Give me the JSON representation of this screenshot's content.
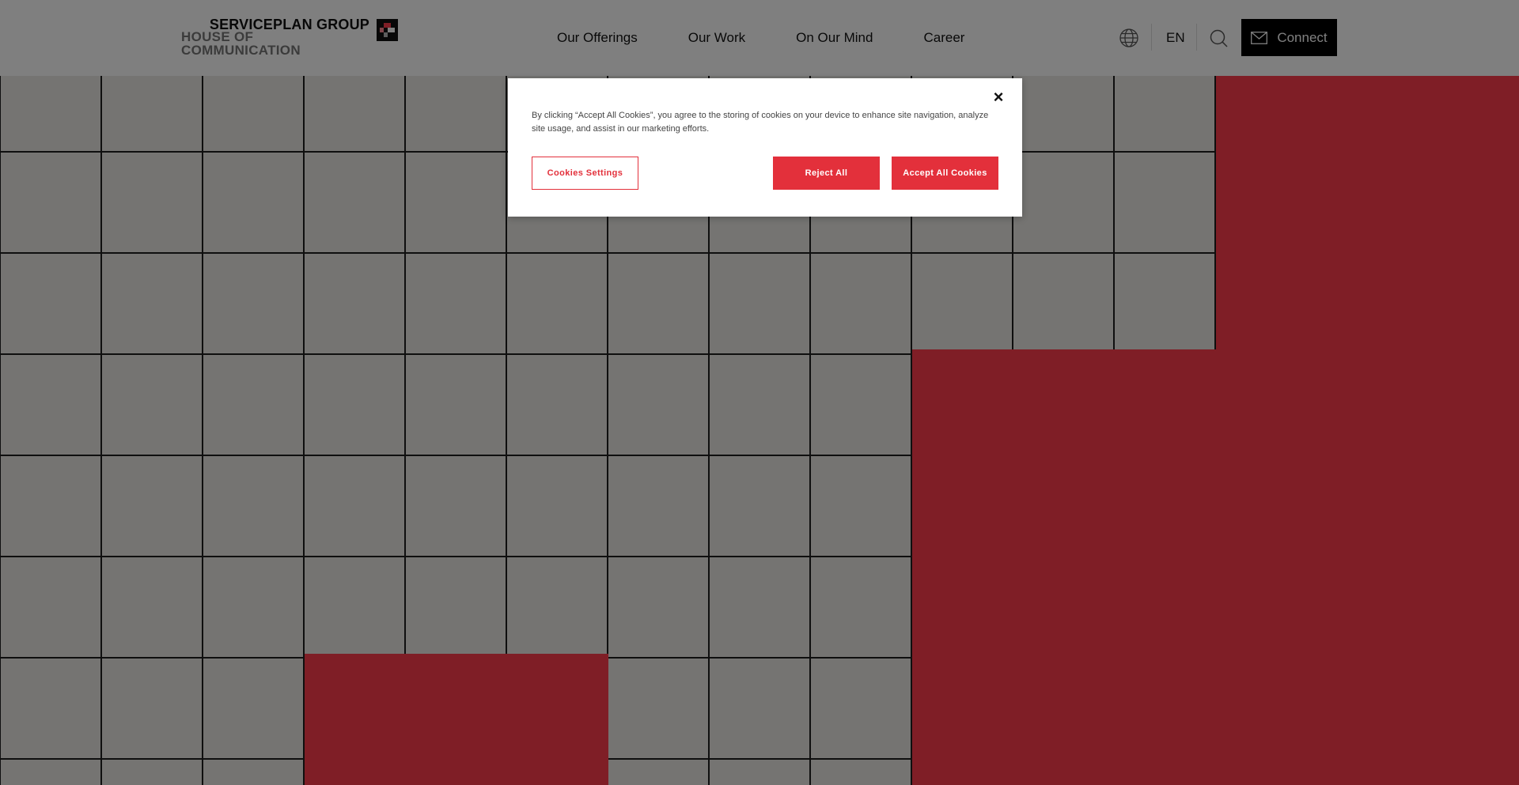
{
  "header": {
    "logo_top": "SERVICEPLAN GROUP",
    "logo_bottom": "HOUSE OF COMMUNICATION",
    "nav": [
      "Our Offerings",
      "Our Work",
      "On Our Mind",
      "Career"
    ],
    "language": "EN",
    "connect_label": "Connect"
  },
  "cookie_dialog": {
    "text": "By clicking “Accept All Cookies”, you agree to the storing of cookies on your device to enhance site navigation, analyze site usage, and assist in our marketing efforts.",
    "close_symbol": "×",
    "settings_label": "Cookies Settings",
    "reject_label": "Reject All",
    "accept_label": "Accept All Cookies"
  },
  "colors": {
    "accent_red": "#e3303b",
    "tile_red": "#ff3d4d",
    "tile_light": "#eae9e4",
    "overlay": "rgba(0,0,0,0.5)"
  }
}
